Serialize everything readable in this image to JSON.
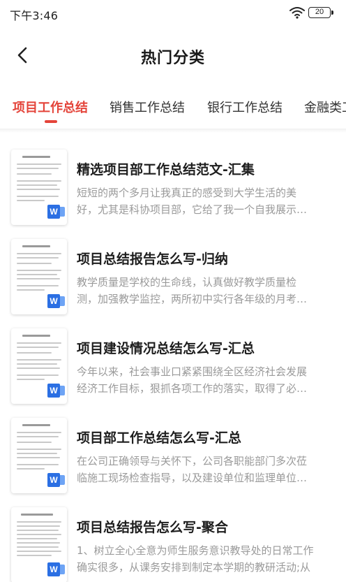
{
  "status_bar": {
    "time": "下午3:46",
    "battery": "20"
  },
  "header": {
    "title": "热门分类"
  },
  "tabs": [
    {
      "label": "项目工作总结",
      "active": true
    },
    {
      "label": "销售工作总结",
      "active": false
    },
    {
      "label": "银行工作总结",
      "active": false
    },
    {
      "label": "金融类工",
      "active": false
    }
  ],
  "colors": {
    "accent": "#e4443a",
    "word_icon": "#2b6fe3"
  },
  "items": [
    {
      "title": "精选项目部工作总结范文-汇集",
      "desc_line1": "短短的两个多月让我真正的感受到大学生活的美",
      "desc_line2": "好，尤其是科协项目部，它给了我一个自我展示…",
      "icon": "word-doc-icon"
    },
    {
      "title": "项目总结报告怎么写-归纳",
      "desc_line1": "教学质量是学校的生命线，认真做好教学质量检",
      "desc_line2": "测，加强教学监控，两所初中实行各年级的月考…",
      "icon": "word-doc-icon"
    },
    {
      "title": "项目建设情况总结怎么写-汇总",
      "desc_line1": "今年以来，社会事业口紧紧围绕全区经济社会发展",
      "desc_line2": "经济工作目标，狠抓各项工作的落实，取得了必…",
      "icon": "word-doc-icon"
    },
    {
      "title": "项目部工作总结怎么写-汇总",
      "desc_line1": "在公司正确领导与关怀下，公司各职能部门多次莅",
      "desc_line2": "临施工现场检查指导，以及建设单位和监理单位…",
      "icon": "word-doc-icon"
    },
    {
      "title": "项目总结报告怎么写-聚合",
      "desc_line1": "1、树立全心全意为师生服务意识教导处的日常工作",
      "desc_line2": "确实很多，从课务安排到制定本学期的教研活动;从",
      "icon": "word-doc-icon"
    }
  ]
}
